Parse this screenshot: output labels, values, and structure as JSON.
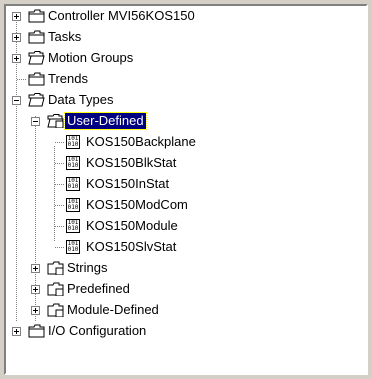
{
  "tree": {
    "controller": "Controller MVI56KOS150",
    "tasks": "Tasks",
    "motion_groups": "Motion Groups",
    "trends": "Trends",
    "data_types": "Data Types",
    "user_defined": "User-Defined",
    "types": [
      "KOS150Backplane",
      "KOS150BlkStat",
      "KOS150InStat",
      "KOS150ModCom",
      "KOS150Module",
      "KOS150SlvStat"
    ],
    "strings": "Strings",
    "predefined": "Predefined",
    "module_defined": "Module-Defined",
    "io_configuration": "I/O Configuration"
  },
  "icon_text": {
    "tag": "101\n010"
  }
}
